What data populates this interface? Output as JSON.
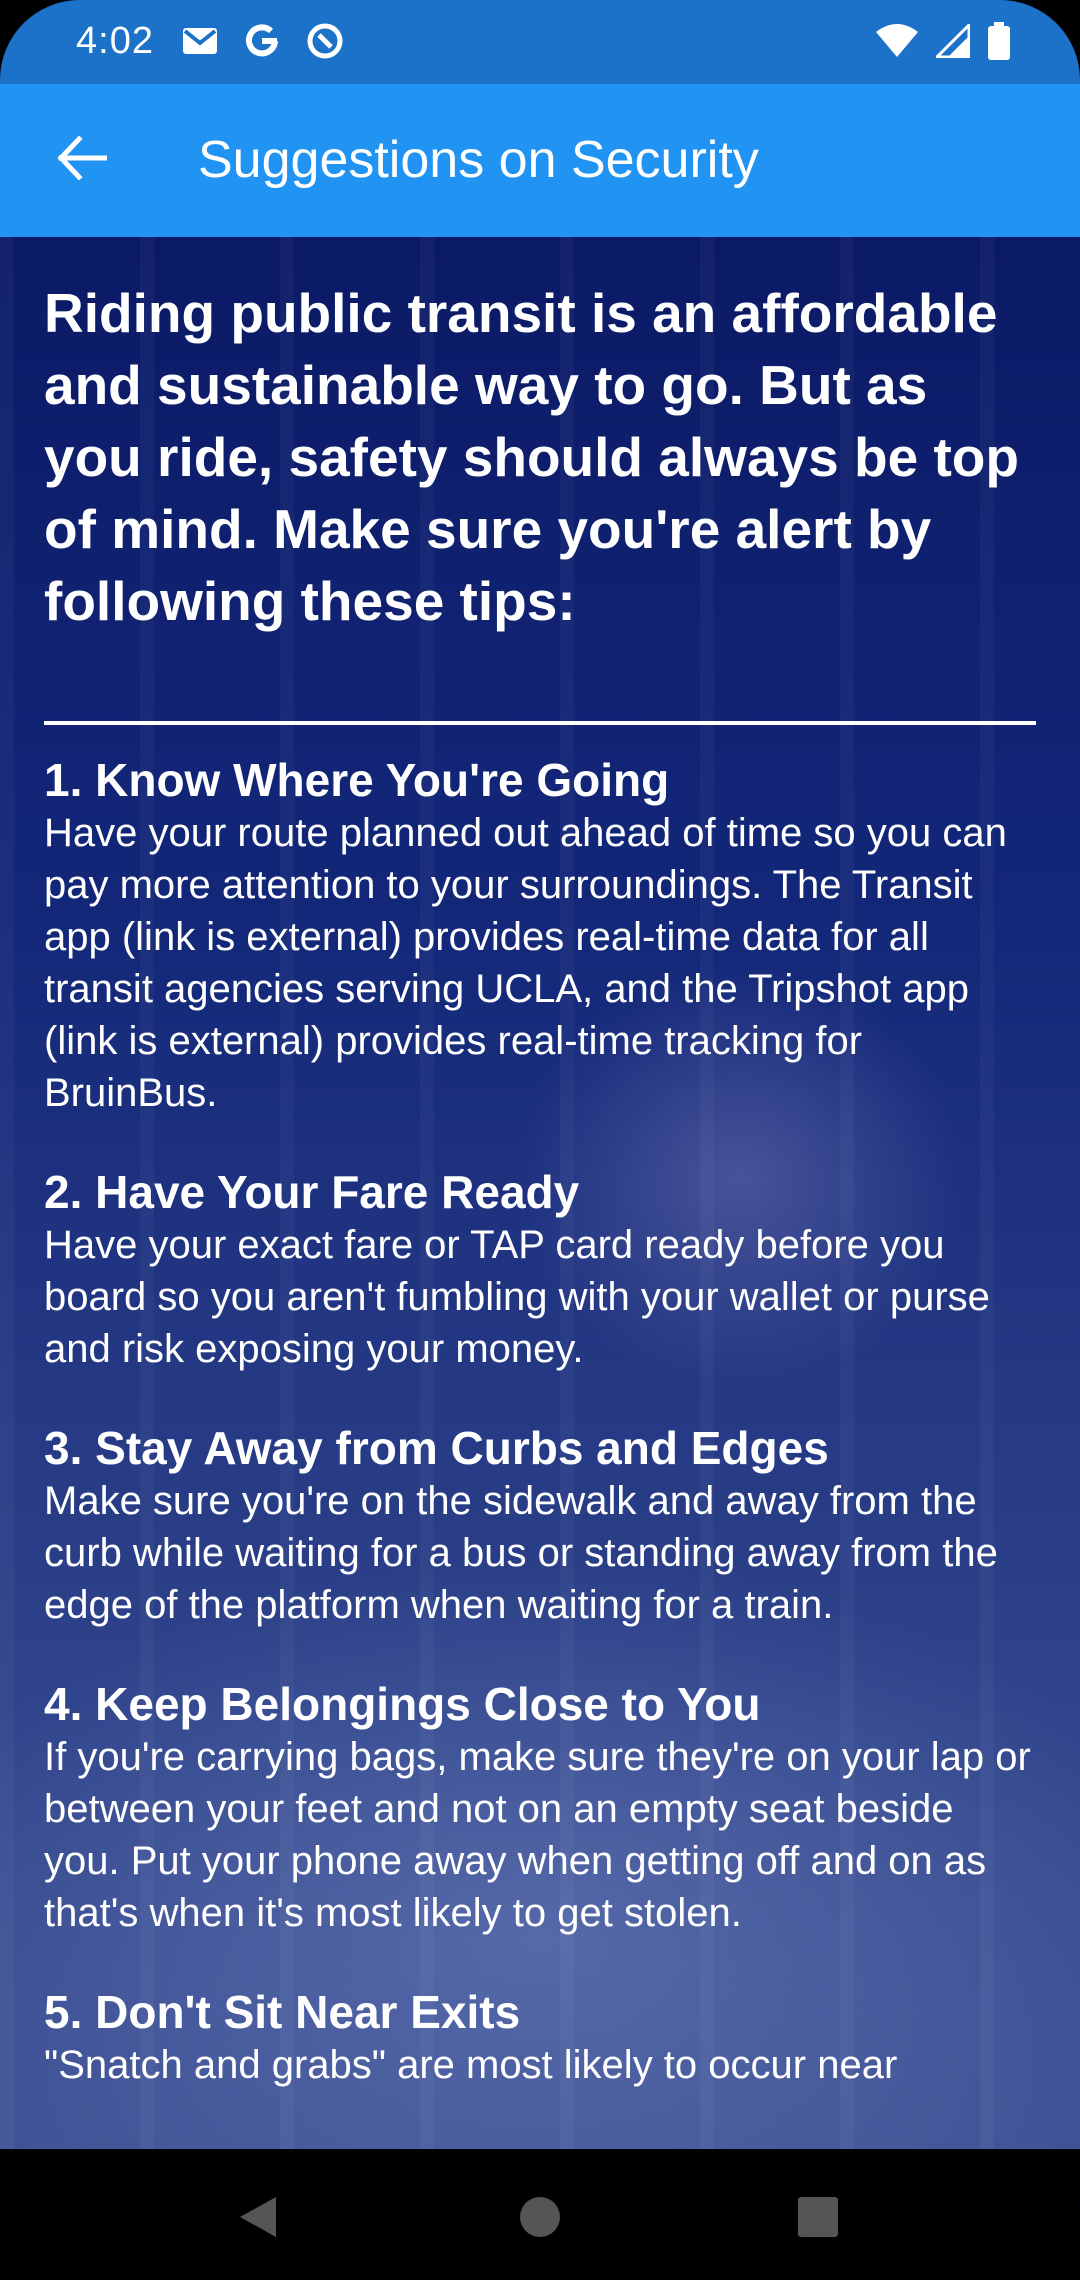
{
  "status_bar": {
    "time": "4:02",
    "left_icons": [
      "gmail-icon",
      "google-icon",
      "data-saver-icon"
    ],
    "right_icons": [
      "wifi-icon",
      "signal-icon",
      "battery-icon"
    ]
  },
  "app_bar": {
    "title": "Suggestions on Security",
    "back_icon": "arrow-back-icon"
  },
  "content": {
    "intro": "Riding public transit is an affordable and sustainable way to go. But as you ride, safety should always be top of mind. Make sure you're alert by following these tips:",
    "tips": [
      {
        "title": "1. Know Where You're Going",
        "body": "Have your route planned out ahead of time so you can pay more attention to your surroundings. The Transit app (link is external) provides real-time data for all transit agencies serving UCLA, and the Tripshot app (link is external) provides real-time tracking for BruinBus."
      },
      {
        "title": "2. Have Your Fare Ready",
        "body": "Have your exact fare or TAP card ready before you board so you aren't fumbling with your wallet or purse and risk exposing your money."
      },
      {
        "title": "3. Stay Away from Curbs and Edges",
        "body": "Make sure you're on the sidewalk and away from the curb while waiting for a bus or standing away from the edge of the platform when waiting for a train."
      },
      {
        "title": "4. Keep Belongings Close to You",
        "body": "If you're carrying bags, make sure they're on your lap or between your feet and not on an empty seat beside you. Put your phone away when getting off and on as that's when it's most likely to get stolen."
      },
      {
        "title": "5. Don't Sit Near Exits",
        "body": "\"Snatch and grabs\" are most likely to occur near"
      }
    ]
  },
  "nav_bar": {
    "buttons": [
      "back-triangle-icon",
      "home-circle-icon",
      "recents-square-icon"
    ]
  },
  "colors": {
    "status_bar": "#1c72c9",
    "app_bar": "#2193f2",
    "content_bg": "#0d1f6b",
    "text": "#ffffff"
  }
}
